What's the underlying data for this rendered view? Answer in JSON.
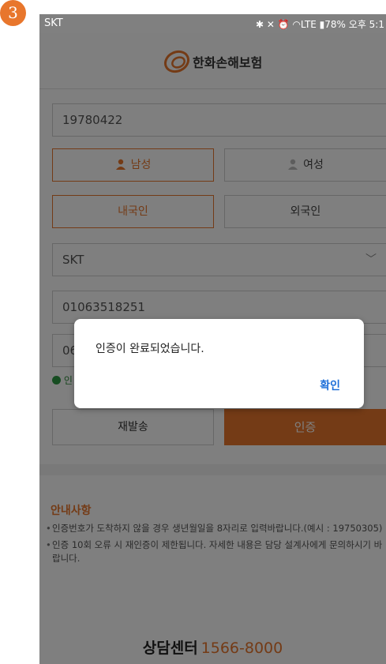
{
  "step_badge": "3",
  "status_bar": {
    "carrier": "SKT",
    "indicators": "✱ ✕ ⏰ ◠LTE ▮78%",
    "battery": "78%",
    "time": "오후 5:1"
  },
  "header": {
    "logo_text": "한화손해보험",
    "logo_color": "#e8762c"
  },
  "form": {
    "birthdate": "19780422",
    "gender_male": "남성",
    "gender_female": "여성",
    "nationality_domestic": "내국인",
    "nationality_foreign": "외국인",
    "carrier_select": "SKT",
    "phone_number": "01063518251",
    "code_partial": "06",
    "verified_partial": "인"
  },
  "buttons": {
    "resend": "재발송",
    "verify": "인증"
  },
  "notice": {
    "title": "안내사항",
    "items": [
      "인증번호가 도착하지 않을 경우 생년월일을 8자리로 입력바랍니다.(예시 : 19750305)",
      "인증 10회 오류 시 재인증이 제한됩니다. 자세한 내용은 담당 설계사에게 문의하시기 바랍니다."
    ]
  },
  "contact": {
    "label": "상담센터",
    "number": "1566-8000"
  },
  "dialog": {
    "message": "인증이 완료되었습니다.",
    "confirm": "확인"
  },
  "colors": {
    "accent": "#e8762c",
    "link": "#1e6fd9"
  }
}
